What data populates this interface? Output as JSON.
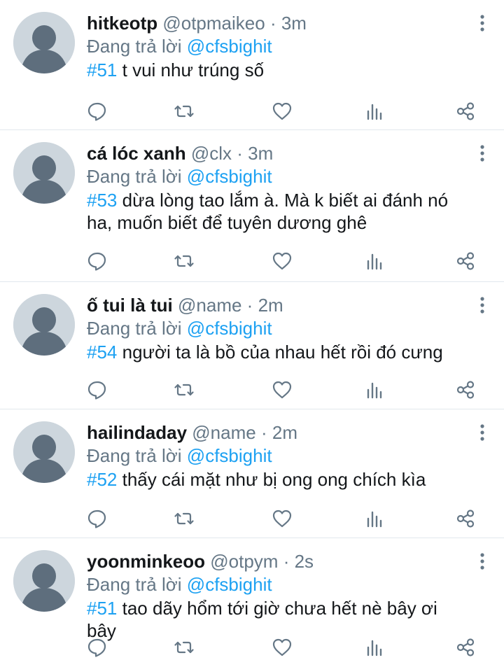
{
  "colors": {
    "accent": "#1da1f2",
    "secondary_text": "#657786",
    "primary_text": "#14171a",
    "avatar_bg": "#cdd6dd",
    "avatar_fg": "#5e6e7d",
    "divider": "#e1e8ed"
  },
  "tweets": [
    {
      "name": "hitkeotp",
      "handle": "@otpmaikeo",
      "separator": "·",
      "time": "3m",
      "reply_prefix": "Đang trả lời",
      "reply_to": "@cfsbighit",
      "hashtag": "#51",
      "body": "t vui như trúng số"
    },
    {
      "name": "cá lóc xanh",
      "handle": "@clx",
      "separator": "·",
      "time": "3m",
      "reply_prefix": "Đang trả lời",
      "reply_to": "@cfsbighit",
      "hashtag": "#53",
      "body": "dừa lòng tao lắm à. Mà k biết ai đánh nó ha, muốn biết để tuyên dương ghê"
    },
    {
      "name": "ố tui là tui",
      "handle": "@name",
      "separator": "·",
      "time": "2m",
      "reply_prefix": "Đang trả lời",
      "reply_to": "@cfsbighit",
      "hashtag": "#54",
      "body": "người ta là bồ của nhau hết rồi đó cưng"
    },
    {
      "name": "hailindaday",
      "handle": "@name",
      "separator": "·",
      "time": "2m",
      "reply_prefix": "Đang trả lời",
      "reply_to": "@cfsbighit",
      "hashtag": "#52",
      "body": "thấy cái mặt như bị ong ong chích kìa"
    },
    {
      "name": "yoonminkeoo",
      "handle": "@otpym",
      "separator": "·",
      "time": "2s",
      "reply_prefix": "Đang trả lời",
      "reply_to": "@cfsbighit",
      "hashtag": "#51",
      "body": "tao dãy hổm tới giờ chưa hết nè bây ơi bây"
    }
  ],
  "icons": {
    "avatar": "default-avatar-icon",
    "more": "more-vertical-icon",
    "reply": "reply-bubble-icon",
    "retweet": "retweet-icon",
    "like": "heart-icon",
    "analytics": "analytics-bars-icon",
    "share": "share-icon"
  }
}
